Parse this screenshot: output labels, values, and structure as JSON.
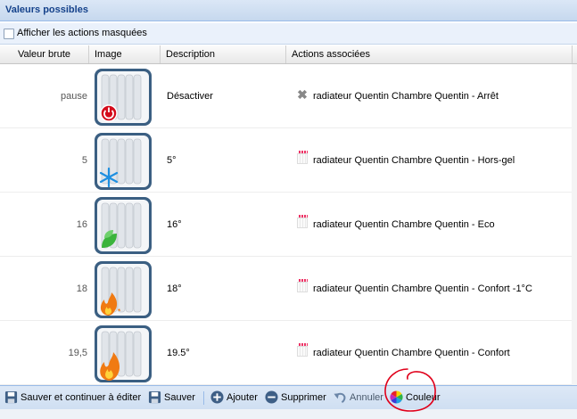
{
  "panel": {
    "title": "Valeurs possibles"
  },
  "option": {
    "label": "Afficher les actions masquées"
  },
  "columns": [
    "Valeur brute",
    "Image",
    "Description",
    "Actions associées"
  ],
  "rows": [
    {
      "value": "pause",
      "icon": "radiator-power-icon",
      "description": "Désactiver",
      "action_icon": "x-icon",
      "action": "radiateur Quentin Chambre Quentin - Arrêt"
    },
    {
      "value": "5",
      "icon": "radiator-snowflake-icon",
      "description": "5°",
      "action_icon": "radiator-small-icon",
      "action": "radiateur Quentin Chambre Quentin - Hors-gel"
    },
    {
      "value": "16",
      "icon": "radiator-leaf-icon",
      "description": "16°",
      "action_icon": "radiator-small-icon",
      "action": "radiateur Quentin Chambre Quentin - Eco"
    },
    {
      "value": "18",
      "icon": "radiator-flame-small-icon",
      "description": "18°",
      "action_icon": "radiator-small-icon",
      "action": "radiateur Quentin Chambre Quentin - Confort -1°C"
    },
    {
      "value": "19,5",
      "icon": "radiator-flame-icon",
      "description": "19.5°",
      "action_icon": "radiator-small-icon",
      "action": "radiateur Quentin Chambre Quentin - Confort"
    }
  ],
  "toolbar": {
    "save_continue": "Sauver et continuer à éditer",
    "save": "Sauver",
    "add": "Ajouter",
    "delete": "Supprimer",
    "cancel": "Annuler",
    "color": "Couleur"
  },
  "colors": {
    "header_text": "#15428b",
    "annotation": "#e0001a"
  }
}
